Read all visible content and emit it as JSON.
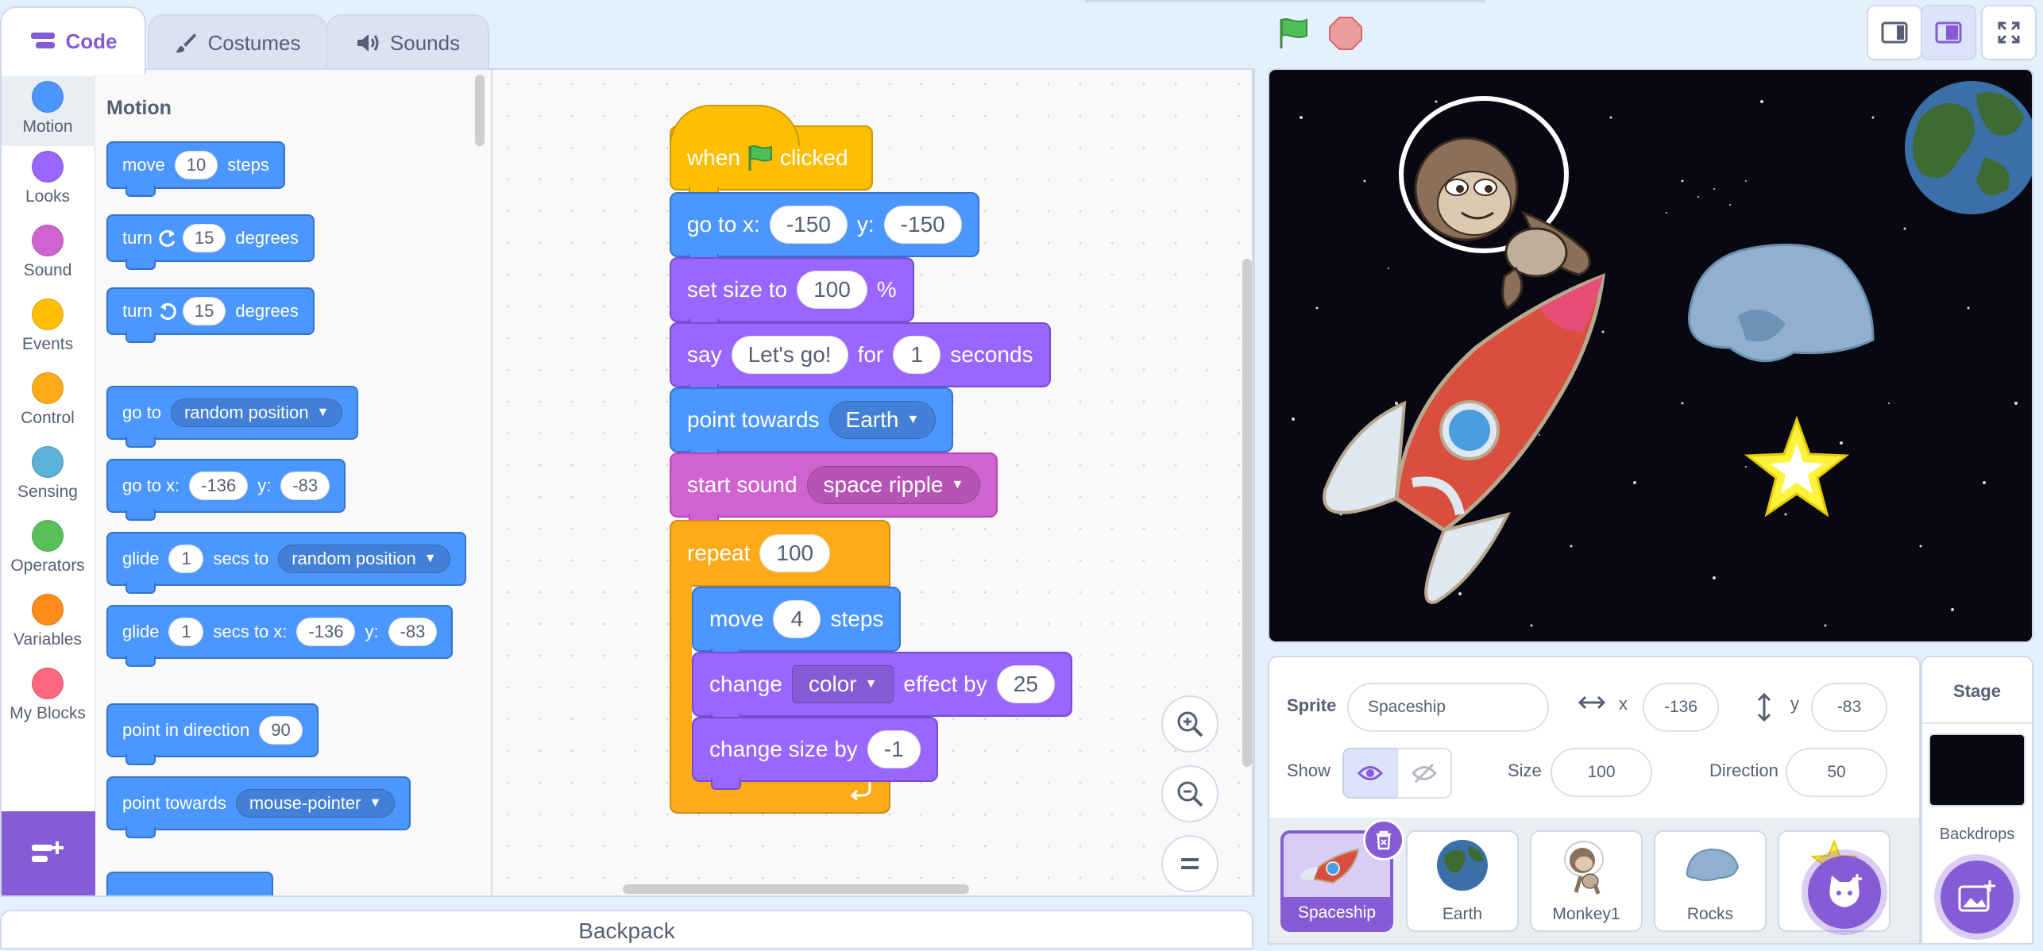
{
  "tabs": [
    {
      "label": "Code"
    },
    {
      "label": "Costumes"
    },
    {
      "label": "Sounds"
    }
  ],
  "categories": [
    {
      "label": "Motion",
      "color": "#4c97ff"
    },
    {
      "label": "Looks",
      "color": "#9966ff"
    },
    {
      "label": "Sound",
      "color": "#cf63cf"
    },
    {
      "label": "Events",
      "color": "#ffbf00"
    },
    {
      "label": "Control",
      "color": "#ffab19"
    },
    {
      "label": "Sensing",
      "color": "#5cb1d6"
    },
    {
      "label": "Operators",
      "color": "#59c059"
    },
    {
      "label": "Variables",
      "color": "#ff8c1a"
    },
    {
      "label": "My Blocks",
      "color": "#ff6680"
    }
  ],
  "palette": {
    "heading": "Motion",
    "move": {
      "pre": "move",
      "val": "10",
      "post": "steps"
    },
    "turn_cw": {
      "pre": "turn",
      "val": "15",
      "post": "degrees"
    },
    "turn_ccw": {
      "pre": "turn",
      "val": "15",
      "post": "degrees"
    },
    "goto": {
      "pre": "go to",
      "opt": "random position"
    },
    "gotoxy": {
      "pre": "go to x:",
      "x": "-136",
      "ylabel": "y:",
      "y": "-83"
    },
    "glide_to": {
      "pre": "glide",
      "val": "1",
      "mid": "secs to",
      "opt": "random position"
    },
    "glide_xy": {
      "pre": "glide",
      "val": "1",
      "mid": "secs to x:",
      "x": "-136",
      "ylabel": "y:",
      "y": "-83"
    },
    "point_dir": {
      "pre": "point in direction",
      "val": "90"
    },
    "point_towards": {
      "pre": "point towards",
      "opt": "mouse-pointer"
    }
  },
  "script": {
    "when": {
      "pre": "when",
      "post": "clicked"
    },
    "gotoxy": {
      "pre": "go to x:",
      "x": "-150",
      "ylabel": "y:",
      "y": "-150"
    },
    "setsize": {
      "pre": "set size to",
      "val": "100",
      "post": "%"
    },
    "say": {
      "pre": "say",
      "text": "Let's go!",
      "mid": "for",
      "secs": "1",
      "post": "seconds"
    },
    "point": {
      "pre": "point towards",
      "opt": "Earth"
    },
    "sound": {
      "pre": "start sound",
      "opt": "space ripple"
    },
    "repeat": {
      "pre": "repeat",
      "val": "100"
    },
    "move": {
      "pre": "move",
      "val": "4",
      "post": "steps"
    },
    "effect": {
      "pre": "change",
      "opt": "color",
      "mid": "effect by",
      "val": "25"
    },
    "size": {
      "pre": "change size by",
      "val": "-1"
    }
  },
  "backpack": "Backpack",
  "sprite_info": {
    "sprite_label": "Sprite",
    "sprite_name": "Spaceship",
    "x_label": "x",
    "x": "-136",
    "y_label": "y",
    "y": "-83",
    "show_label": "Show",
    "size_label": "Size",
    "size": "100",
    "direction_label": "Direction",
    "direction": "50"
  },
  "sprites": [
    {
      "name": "Spaceship"
    },
    {
      "name": "Earth"
    },
    {
      "name": "Monkey1"
    },
    {
      "name": "Rocks"
    }
  ],
  "stage_panel": {
    "title": "Stage",
    "backdrops": "Backdrops"
  }
}
